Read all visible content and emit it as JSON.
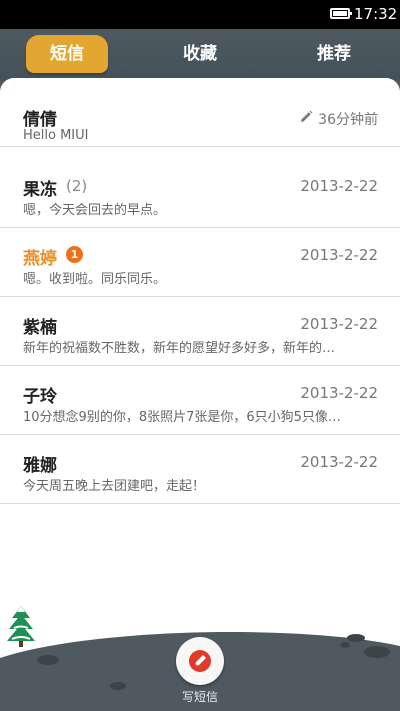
{
  "status_bar": {
    "time": "17:32"
  },
  "tabs": [
    {
      "label": "短信",
      "active": true
    },
    {
      "label": "收藏",
      "active": false
    },
    {
      "label": "推荐",
      "active": false
    }
  ],
  "threads": [
    {
      "name": "倩倩",
      "meta": "36分钟前",
      "preview": "Hello MIUI",
      "draft": true
    },
    {
      "name": "果冻",
      "count": "(2)",
      "date": "2013-2-22",
      "preview": "嗯，今天会回去的早点。"
    },
    {
      "name": "燕婷",
      "badge": "1",
      "date": "2013-2-22",
      "preview": "嗯。收到啦。同乐同乐。"
    },
    {
      "name": "紫楠",
      "date": "2013-2-22",
      "preview": "新年的祝福数不胜数，新年的愿望好多好多，新年的…"
    },
    {
      "name": "子玲",
      "date": "2013-2-22",
      "preview": "10分想念9别的你，8张照片7张是你，6只小狗5只像…"
    },
    {
      "name": "雅娜",
      "date": "2013-2-22",
      "preview": "今天周五晚上去团建吧，走起！"
    }
  ],
  "compose": {
    "label": "写短信",
    "icon": "compose-icon"
  },
  "colors": {
    "accent": "#e2a631",
    "unread": "#f0701a",
    "header": "#4e5a60"
  }
}
